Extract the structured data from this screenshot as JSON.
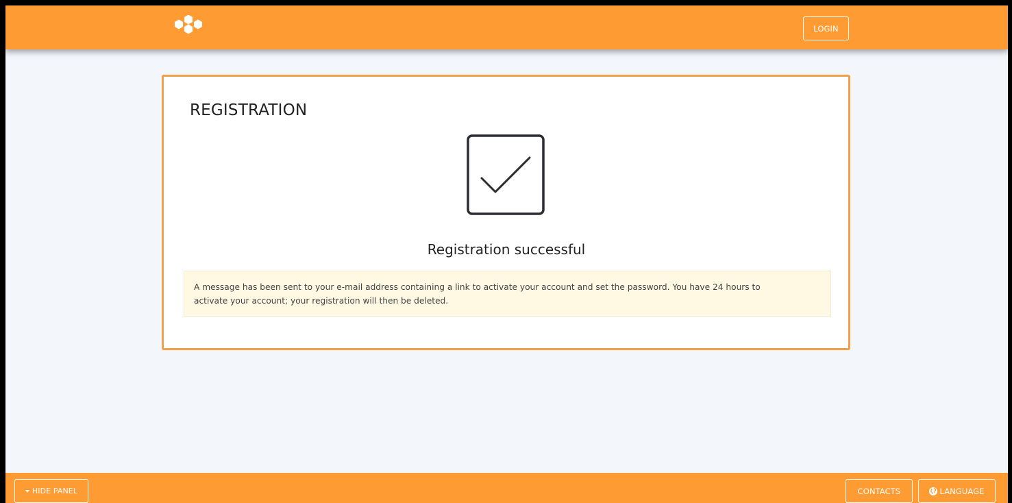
{
  "header": {
    "login_label": "LOGIN"
  },
  "card": {
    "title": "REGISTRATION",
    "success_message": "Registration successful",
    "info_line1": "A message has been sent to your e-mail address containing a link to activate your account and set the password. You have 24 hours to",
    "info_line2": "activate your account; your registration will then be deleted."
  },
  "footer": {
    "hide_panel_label": "HIDE PANEL",
    "contacts_label": "CONTACTS",
    "language_label": "LANGUAGE"
  },
  "icons": {
    "logo": "hexagon-cluster-logo-icon",
    "success": "checkbox-checked-icon",
    "caret": "caret-down-icon",
    "globe": "globe-icon"
  },
  "colors": {
    "brand_orange": "#ff9b33",
    "card_border": "#f0a04b",
    "page_background": "#f3f7fc",
    "alert_background": "#fff8e3"
  }
}
